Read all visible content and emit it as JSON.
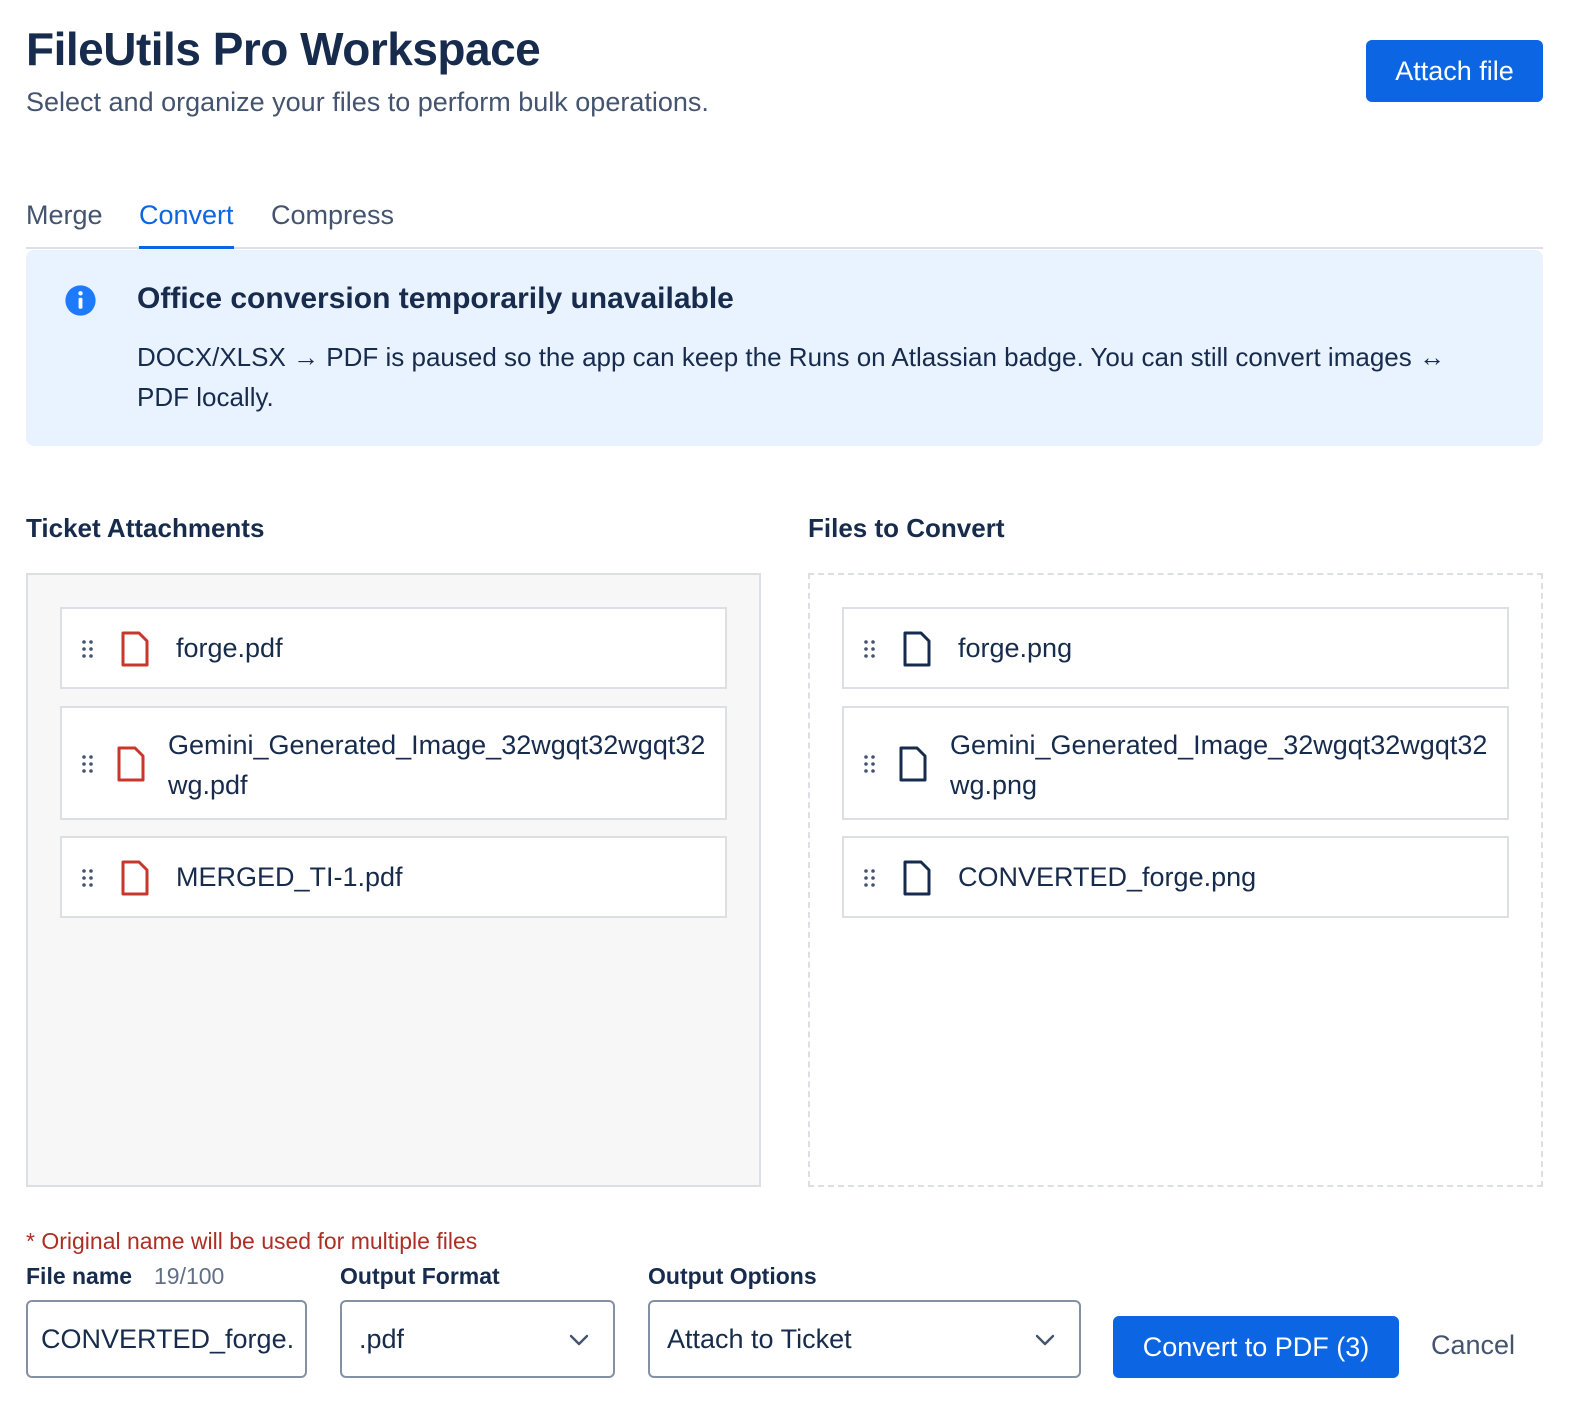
{
  "header": {
    "title": "FileUtils Pro Workspace",
    "subtitle": "Select and organize your files to perform bulk operations.",
    "attach_button": "Attach file"
  },
  "tabs": [
    {
      "label": "Merge",
      "active": false
    },
    {
      "label": "Convert",
      "active": true
    },
    {
      "label": "Compress",
      "active": false
    }
  ],
  "banner": {
    "icon": "info-icon",
    "title": "Office conversion temporarily unavailable",
    "text": "DOCX/XLSX → PDF is paused so the app can keep the Runs on Atlassian badge. You can still convert images ↔ PDF locally."
  },
  "ticket_attachments": {
    "title": "Ticket Attachments",
    "files": [
      {
        "name": "forge.pdf",
        "icon": "pdf-file-icon"
      },
      {
        "name": "Gemini_Generated_Image_32wgqt32wgqt32wg.pdf",
        "icon": "pdf-file-icon"
      },
      {
        "name": "MERGED_TI-1.pdf",
        "icon": "pdf-file-icon"
      }
    ]
  },
  "files_to_convert": {
    "title": "Files to Convert",
    "files": [
      {
        "name": "forge.png",
        "icon": "image-file-icon"
      },
      {
        "name": "Gemini_Generated_Image_32wgqt32wgqt32wg.png",
        "icon": "image-file-icon"
      },
      {
        "name": "CONVERTED_forge.png",
        "icon": "image-file-icon"
      }
    ]
  },
  "form": {
    "note": "* Original name will be used for multiple files",
    "file_name_label": "File name",
    "file_name_count": "19/100",
    "file_name_value": "CONVERTED_forge.",
    "output_format_label": "Output Format",
    "output_format_value": ".pdf",
    "output_options_label": "Output Options",
    "output_options_value": "Attach to Ticket",
    "convert_button": "Convert to PDF (3)",
    "cancel_button": "Cancel"
  },
  "colors": {
    "primary": "#0c66e4",
    "pdf_icon": "#c9372c",
    "error_text": "#ae2e24",
    "banner_bg": "#e9f2ff",
    "info_icon": "#1d7afc"
  }
}
